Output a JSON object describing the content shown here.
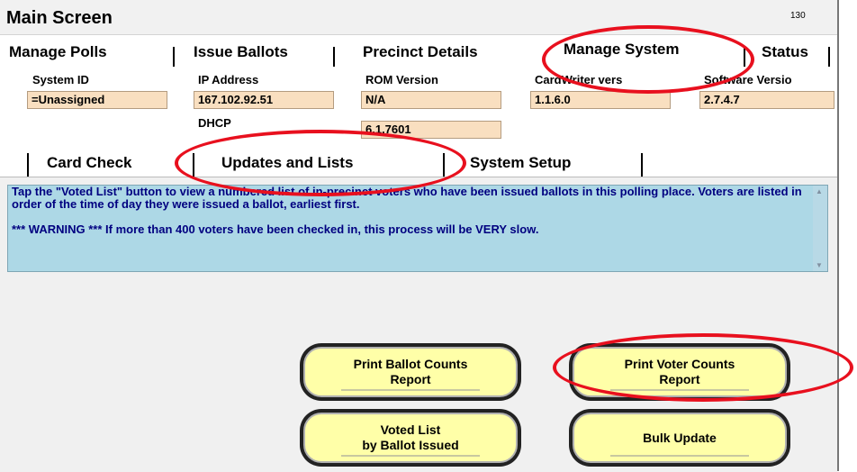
{
  "window": {
    "title": "Main Screen",
    "counter": "130"
  },
  "main_tabs": [
    "Manage Polls",
    "Issue Ballots",
    "Precinct Details",
    "Manage System",
    "Status"
  ],
  "system_info": {
    "system_id": {
      "label": "System ID",
      "value": "=Unassigned"
    },
    "ip_address": {
      "label": "IP Address",
      "value": "167.102.92.51"
    },
    "rom_version": {
      "label": "ROM Version",
      "value": "N/A"
    },
    "cardwriter": {
      "label": "CardWriter vers",
      "value": "1.1.6.0"
    },
    "software": {
      "label": "Software Versio",
      "value": "2.7.4.7"
    },
    "dhcp": {
      "label": "DHCP",
      "value": "6.1.7601"
    }
  },
  "sub_tabs": [
    "Card Check",
    "Updates and Lists",
    "System Setup"
  ],
  "info": {
    "text": "Tap the \"Voted List\"  button to view a numbered list of in-precinct voters who have been issued ballots in this polling place.  Voters are listed in order of the time of day they were issued a ballot, earliest first.",
    "warning": "*** WARNING *** If more than 400 voters have been checked in, this process will be VERY slow."
  },
  "buttons": {
    "print_ballot": "Print Ballot Counts\nReport",
    "print_voter": "Print Voter Counts\nReport",
    "voted_list": "Voted List\nby Ballot Issued",
    "bulk_update": "Bulk Update"
  },
  "highlight_color": "#e8101e"
}
